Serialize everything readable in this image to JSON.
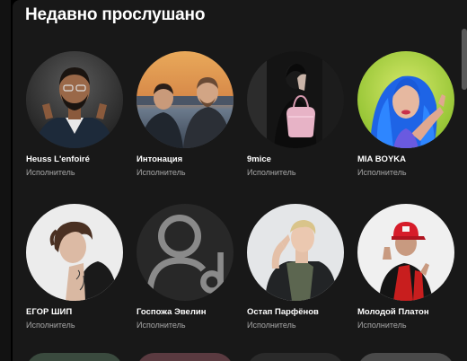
{
  "section": {
    "title": "Недавно прослушано"
  },
  "artists": [
    {
      "name": "Heuss L'enfoiré",
      "type": "Исполнитель",
      "image": "portrait-man-beard"
    },
    {
      "name": "Интонация",
      "type": "Исполнитель",
      "image": "two-men-sunset"
    },
    {
      "name": "9mice",
      "type": "Исполнитель",
      "image": "person-pink-bag"
    },
    {
      "name": "MIA BOYKA",
      "type": "Исполнитель",
      "image": "blue-hair-woman"
    },
    {
      "name": "ЕГОР ШИП",
      "type": "Исполнитель",
      "image": "young-man-tattoo"
    },
    {
      "name": "Госпожа Эвелин",
      "type": "Исполнитель",
      "image": "user-placeholder-icon"
    },
    {
      "name": "Остап Парфёнов",
      "type": "Исполнитель",
      "image": "young-man-blonde"
    },
    {
      "name": "Молодой Платон",
      "type": "Исполнитель",
      "image": "red-cap-man"
    }
  ],
  "colors": {
    "background": "#181818",
    "text_primary": "#ffffff",
    "text_secondary": "#a7a7a7"
  }
}
